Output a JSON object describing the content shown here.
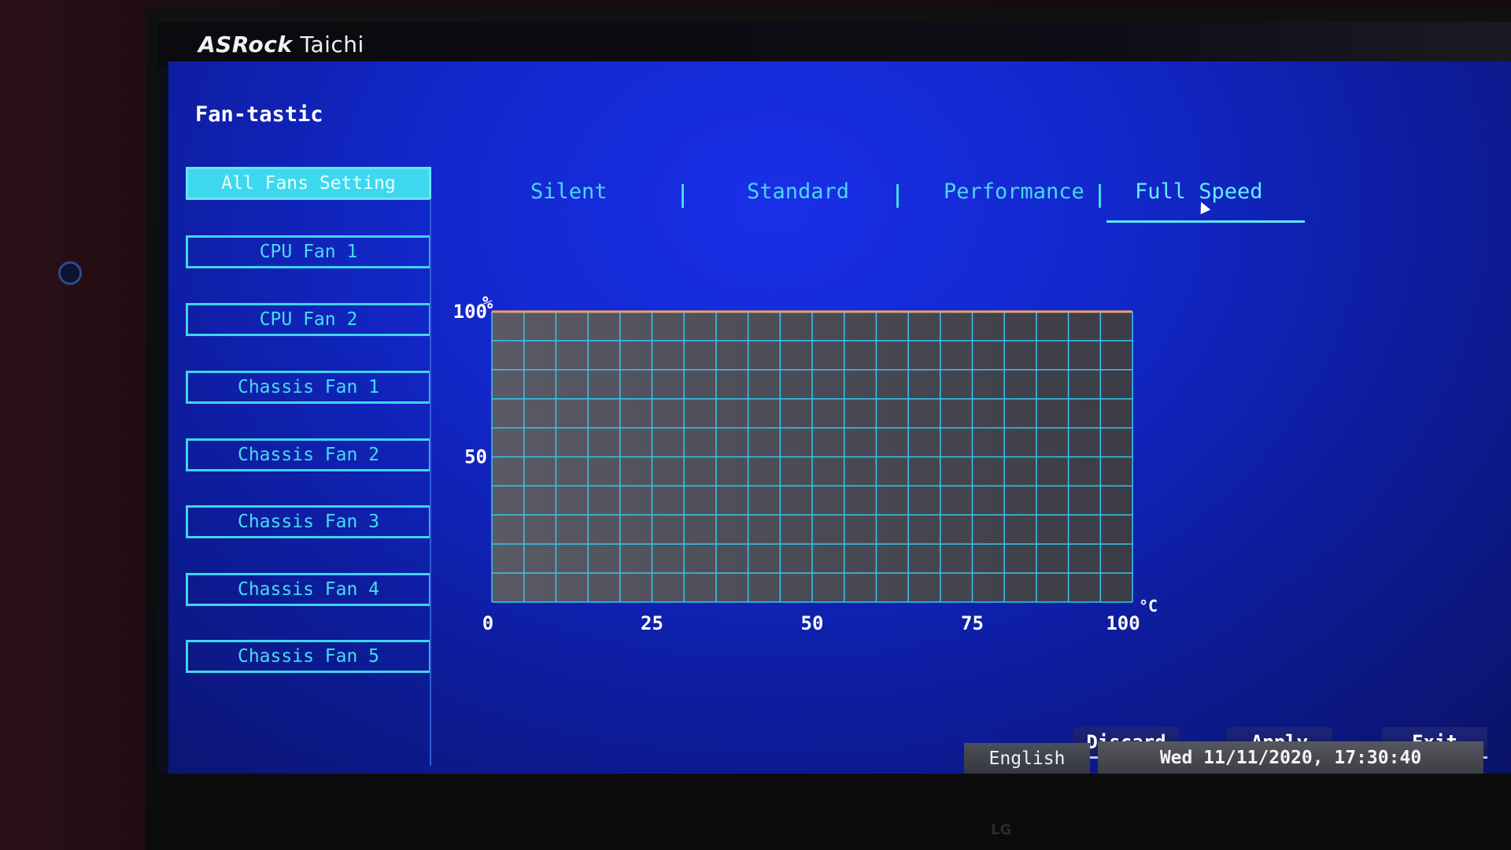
{
  "window": {
    "brand": "ASRock",
    "model": "Taichi"
  },
  "page": {
    "title": "Fan-tastic"
  },
  "fans": [
    {
      "label": "All Fans Setting",
      "active": true
    },
    {
      "label": "CPU Fan 1",
      "active": false
    },
    {
      "label": "CPU Fan 2",
      "active": false
    },
    {
      "label": "Chassis Fan 1",
      "active": false
    },
    {
      "label": "Chassis Fan 2",
      "active": false
    },
    {
      "label": "Chassis Fan 3",
      "active": false
    },
    {
      "label": "Chassis Fan 4",
      "active": false
    },
    {
      "label": "Chassis Fan 5",
      "active": false
    }
  ],
  "modes": [
    {
      "label": "Silent",
      "active": false
    },
    {
      "label": "Standard",
      "active": false
    },
    {
      "label": "Performance",
      "active": false
    },
    {
      "label": "Full Speed",
      "active": true
    }
  ],
  "chart_data": {
    "type": "line",
    "ylabel": "%",
    "xlabel": "°C",
    "xlim": [
      0,
      100
    ],
    "ylim": [
      0,
      100
    ],
    "x_ticks": [
      "0",
      "25",
      "50",
      "75",
      "100"
    ],
    "y_ticks": [
      "100",
      "50"
    ],
    "grid": true,
    "x": [
      0,
      100
    ],
    "y": [
      100,
      100
    ]
  },
  "actions": {
    "discard": "Discard",
    "apply": "Apply",
    "exit": "Exit"
  },
  "status": {
    "language": "English",
    "datetime": "Wed 11/11/2020, 17:30:40"
  },
  "colors": {
    "accent": "#3ed8ee",
    "panel": "#1227c9",
    "grid": "#32c8ee",
    "curve": "#f0a060"
  },
  "icons": {
    "cursor": "mouse-pointer-icon"
  }
}
